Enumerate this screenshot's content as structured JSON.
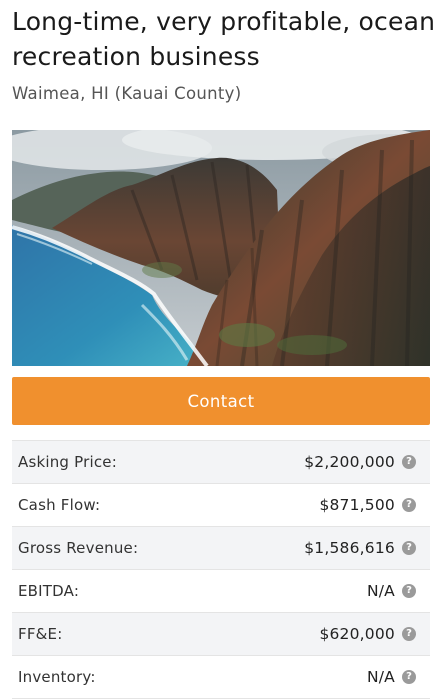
{
  "listing": {
    "title": "Long-time, very profitable, ocean recreation business",
    "location": "Waimea, HI (Kauai County)"
  },
  "hero": {
    "icon": "coastline-photo"
  },
  "contact": {
    "label": "Contact",
    "color": "#f0902e"
  },
  "financials": [
    {
      "label": "Asking Price:",
      "value": "$2,200,000",
      "icon": "help-icon"
    },
    {
      "label": "Cash Flow:",
      "value": "$871,500",
      "icon": "help-icon"
    },
    {
      "label": "Gross Revenue:",
      "value": "$1,586,616",
      "icon": "help-icon"
    },
    {
      "label": "EBITDA:",
      "value": "N/A",
      "icon": "help-icon"
    },
    {
      "label": "FF&E:",
      "value": "$620,000",
      "icon": "help-icon"
    },
    {
      "label": "Inventory:",
      "value": "N/A",
      "icon": "help-icon"
    }
  ],
  "help_glyph": "?"
}
